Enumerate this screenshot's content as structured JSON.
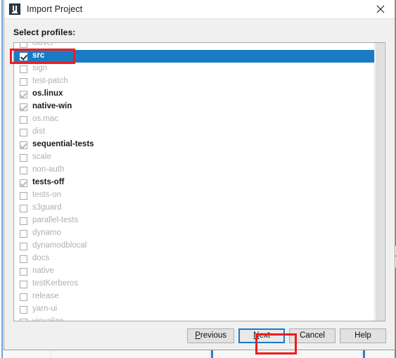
{
  "window": {
    "title": "Import Project",
    "icon": "intellij-idea-icon",
    "close_label": "×"
  },
  "dialog": {
    "section_label": "Select profiles:",
    "profiles": [
      {
        "name": "clover",
        "checked": false,
        "selected": false
      },
      {
        "name": "src",
        "checked": true,
        "selected": true
      },
      {
        "name": "sign",
        "checked": false,
        "selected": false
      },
      {
        "name": "test-patch",
        "checked": false,
        "selected": false
      },
      {
        "name": "os.linux",
        "checked": true,
        "selected": false
      },
      {
        "name": "native-win",
        "checked": true,
        "selected": false
      },
      {
        "name": "os.mac",
        "checked": false,
        "selected": false
      },
      {
        "name": "dist",
        "checked": false,
        "selected": false
      },
      {
        "name": "sequential-tests",
        "checked": true,
        "selected": false
      },
      {
        "name": "scale",
        "checked": false,
        "selected": false
      },
      {
        "name": "non-auth",
        "checked": false,
        "selected": false
      },
      {
        "name": "tests-off",
        "checked": true,
        "selected": false
      },
      {
        "name": "tests-on",
        "checked": false,
        "selected": false
      },
      {
        "name": "s3guard",
        "checked": false,
        "selected": false
      },
      {
        "name": "parallel-tests",
        "checked": false,
        "selected": false
      },
      {
        "name": "dynamo",
        "checked": false,
        "selected": false
      },
      {
        "name": "dynamodblocal",
        "checked": false,
        "selected": false
      },
      {
        "name": "docs",
        "checked": false,
        "selected": false
      },
      {
        "name": "native",
        "checked": false,
        "selected": false
      },
      {
        "name": "testKerberos",
        "checked": false,
        "selected": false
      },
      {
        "name": "release",
        "checked": false,
        "selected": false
      },
      {
        "name": "yarn-ui",
        "checked": false,
        "selected": false
      },
      {
        "name": "visualize",
        "checked": false,
        "selected": false
      }
    ]
  },
  "footer": {
    "buttons": [
      {
        "label": "Previous",
        "mnemonic": "P",
        "focused": false
      },
      {
        "label": "Next",
        "mnemonic": "N",
        "focused": true
      },
      {
        "label": "Cancel",
        "mnemonic": "",
        "focused": false
      },
      {
        "label": "Help",
        "mnemonic": "",
        "focused": false
      }
    ]
  },
  "annotations": {
    "selected_row_highlight": "src",
    "primary_action_highlight": "Next",
    "color": "#ee1c1c"
  },
  "colors": {
    "selection_blue": "#1a7bc4",
    "dialog_background": "#f0f0f0",
    "list_background": "#ffffff",
    "disabled_text": "#b0b0b0",
    "enabled_text": "#1a1a1a"
  }
}
